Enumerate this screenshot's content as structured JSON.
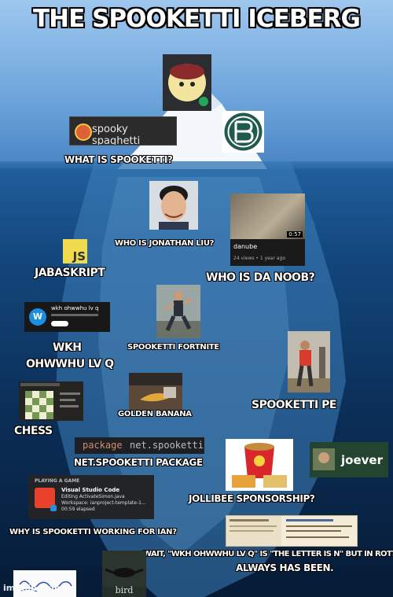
{
  "title": "THE SPOOKETTI ICEBERG",
  "labels": {
    "what": "WHAT IS SPOOKETTI?",
    "who_jonathan": "WHO IS JONATHAN LIU?",
    "jabaskript": "JABASKRIPT",
    "who_noob": "WHO IS DA NOOB?",
    "wkh_line1": "WKH",
    "wkh_line2": "OHWWHU LV Q",
    "fortnite": "SPOOKETTI FORTNITE",
    "pe": "SPOOKETTI PE",
    "golden": "GOLDEN BANANA",
    "chess": "CHESS",
    "package_label": "NET.SPOOKETTI PACKAGE",
    "jollibee": "JOLLIBEE SPONSORSHIP?",
    "working": "WHY IS SPOOKETTI WORKING FOR IAN?",
    "wait": "WAIT, \"WKH OHWWHU LV Q\" IS \"THE LETTER IS N\" BUT IN ROT?!",
    "always": "ALWAYS HAS BEEN."
  },
  "spooky_logo": {
    "text": "spooky spaghetti"
  },
  "youtube_card": {
    "title": "danube",
    "meta": "24 views • 1 year ago",
    "duration": "0:57"
  },
  "channel_card": {
    "title": "wkh ohwwhu lv q",
    "avatar_letter": "W"
  },
  "code_snippet": {
    "keyword": "package",
    "name": "net.spooketti;"
  },
  "joever": {
    "text": "joever"
  },
  "discord_status": {
    "header": "PLAYING A GAME",
    "app": "Visual Studio Code",
    "line1": "Editing ActivateSimon.java",
    "line2": "Workspace: ianproject-template-1...",
    "line3": "00:59 elapsed"
  },
  "bird": {
    "caption": "bird"
  },
  "watermark": "imgflip.com"
}
